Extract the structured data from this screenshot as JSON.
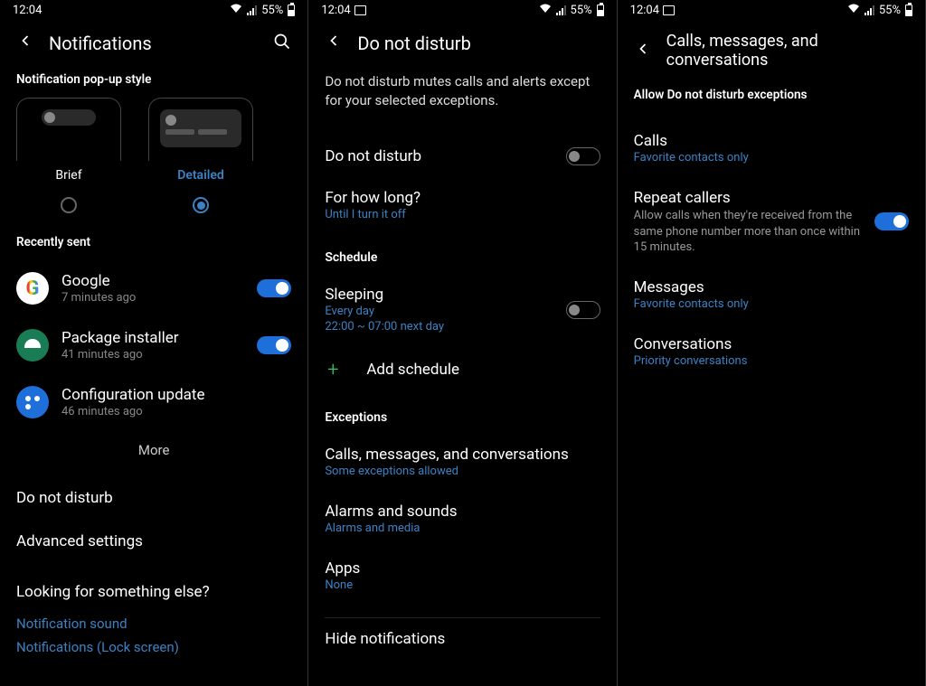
{
  "status": {
    "time": "12:04",
    "battery": "55%"
  },
  "screen1": {
    "title": "Notifications",
    "section_popup": "Notification pop-up style",
    "brief": "Brief",
    "detailed": "Detailed",
    "section_recent": "Recently sent",
    "apps": [
      {
        "name": "Google",
        "time": "7 minutes ago"
      },
      {
        "name": "Package installer",
        "time": "41 minutes ago"
      },
      {
        "name": "Configuration update",
        "time": "46 minutes ago"
      }
    ],
    "more": "More",
    "dnd": "Do not disturb",
    "advanced": "Advanced settings",
    "looking": "Looking for something else?",
    "link1": "Notification sound",
    "link2": "Notifications (Lock screen)"
  },
  "screen2": {
    "title": "Do not disturb",
    "description": "Do not disturb mutes calls and alerts except for your selected exceptions.",
    "dnd": "Do not disturb",
    "how_long": "For how long?",
    "how_long_sub": "Until I turn it off",
    "schedule_header": "Schedule",
    "sleeping": "Sleeping",
    "sleeping_sub1": "Every day",
    "sleeping_sub2": "22:00 ~ 07:00 next day",
    "add_schedule": "Add schedule",
    "exceptions_header": "Exceptions",
    "calls_msgs": "Calls, messages, and conversations",
    "calls_msgs_sub": "Some exceptions allowed",
    "alarms": "Alarms and sounds",
    "alarms_sub": "Alarms and media",
    "apps": "Apps",
    "apps_sub": "None",
    "hide": "Hide notifications"
  },
  "screen3": {
    "title": "Calls, messages, and conversations",
    "allow_header": "Allow Do not disturb exceptions",
    "calls": "Calls",
    "calls_sub": "Favorite contacts only",
    "repeat": "Repeat callers",
    "repeat_sub": "Allow calls when they're received from the same phone number more than once within 15 minutes.",
    "messages": "Messages",
    "messages_sub": "Favorite contacts only",
    "conversations": "Conversations",
    "conversations_sub": "Priority conversations"
  }
}
